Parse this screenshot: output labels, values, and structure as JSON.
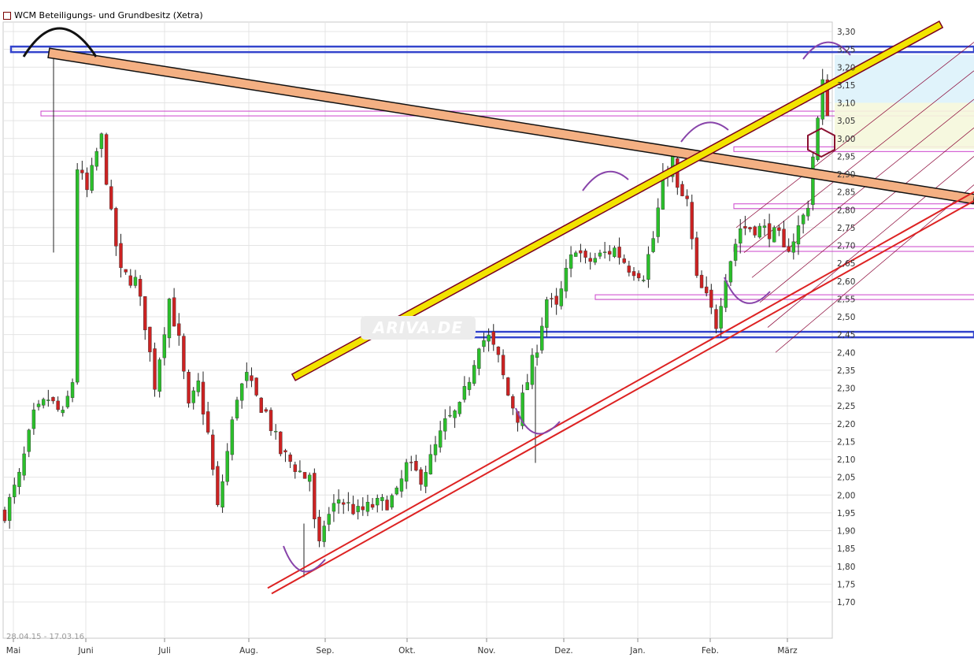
{
  "chart_data": {
    "type": "candlestick",
    "title": "WCM Beteiligungs- und Grundbesitz (Xetra)",
    "date_range": "28.04.15 - 17.03.16",
    "watermark": "ARIVA.DE",
    "y_axis_side": "right",
    "ylim": [
      1.65,
      3.32
    ],
    "y_ticks": [
      "1,70",
      "1,75",
      "1,80",
      "1,85",
      "1,90",
      "1,95",
      "2,00",
      "2,05",
      "2,10",
      "2,15",
      "2,20",
      "2,25",
      "2,30",
      "2,35",
      "2,40",
      "2,45",
      "2,50",
      "2,55",
      "2,60",
      "2,65",
      "2,70",
      "2,75",
      "2,80",
      "2,85",
      "2,90",
      "2,95",
      "3,00",
      "3,05",
      "3,10",
      "3,15",
      "3,20",
      "3,25",
      "3,30"
    ],
    "x_ticks": [
      "Mai",
      "Juni",
      "Juli",
      "Aug.",
      "Sep.",
      "Okt.",
      "Nov.",
      "Dez.",
      "Jan.",
      "Feb.",
      "März"
    ],
    "grid": true,
    "colors": {
      "up": "#2bbf2b",
      "down": "#cc2222",
      "support": "#dd2222",
      "resistance_band": "#3344cc",
      "trend_fill": "#f4b083",
      "channel_fill": "#f2e400",
      "annotation": "#cc44cc",
      "curve": "#8844aa"
    },
    "price_path": [
      [
        0,
        1.95
      ],
      [
        3,
        2.05
      ],
      [
        6,
        2.22
      ],
      [
        9,
        2.27
      ],
      [
        12,
        2.22
      ],
      [
        14,
        2.32
      ],
      [
        15,
        2.92
      ],
      [
        17,
        2.85
      ],
      [
        19,
        2.96
      ],
      [
        20,
        3.0
      ],
      [
        22,
        2.78
      ],
      [
        24,
        2.62
      ],
      [
        27,
        2.6
      ],
      [
        29,
        2.48
      ],
      [
        31,
        2.31
      ],
      [
        34,
        2.55
      ],
      [
        36,
        2.43
      ],
      [
        38,
        2.24
      ],
      [
        40,
        2.31
      ],
      [
        42,
        2.17
      ],
      [
        44,
        1.96
      ],
      [
        46,
        2.12
      ],
      [
        48,
        2.28
      ],
      [
        50,
        2.33
      ],
      [
        52,
        2.27
      ],
      [
        54,
        2.23
      ],
      [
        57,
        2.12
      ],
      [
        60,
        2.08
      ],
      [
        62,
        2.05
      ],
      [
        63,
        2.06
      ],
      [
        64,
        1.92
      ],
      [
        65,
        1.85
      ],
      [
        66,
        1.92
      ],
      [
        69,
        1.99
      ],
      [
        73,
        1.95
      ],
      [
        76,
        1.97
      ],
      [
        79,
        1.98
      ],
      [
        81,
        2.0
      ],
      [
        83,
        2.08
      ],
      [
        86,
        2.05
      ],
      [
        88,
        2.1
      ],
      [
        91,
        2.2
      ],
      [
        94,
        2.24
      ],
      [
        96,
        2.33
      ],
      [
        98,
        2.43
      ],
      [
        100,
        2.44
      ],
      [
        102,
        2.38
      ],
      [
        104,
        2.28
      ],
      [
        106,
        2.22
      ],
      [
        108,
        2.32
      ],
      [
        110,
        2.42
      ],
      [
        112,
        2.55
      ],
      [
        114,
        2.52
      ],
      [
        116,
        2.62
      ],
      [
        118,
        2.7
      ],
      [
        120,
        2.65
      ],
      [
        123,
        2.67
      ],
      [
        126,
        2.69
      ],
      [
        129,
        2.64
      ],
      [
        132,
        2.62
      ],
      [
        134,
        2.72
      ],
      [
        136,
        2.88
      ],
      [
        138,
        2.94
      ],
      [
        139,
        2.85
      ],
      [
        141,
        2.82
      ],
      [
        143,
        2.6
      ],
      [
        145,
        2.55
      ],
      [
        147,
        2.48
      ],
      [
        149,
        2.62
      ],
      [
        152,
        2.75
      ],
      [
        155,
        2.75
      ],
      [
        158,
        2.74
      ],
      [
        160,
        2.72
      ],
      [
        161,
        2.68
      ],
      [
        163,
        2.72
      ],
      [
        165,
        2.78
      ],
      [
        166,
        2.82
      ],
      [
        167,
        2.95
      ],
      [
        168,
        3.05
      ],
      [
        169,
        3.15
      ],
      [
        170,
        3.08
      ]
    ],
    "annotations": [
      {
        "type": "resistance_band",
        "y": 3.25,
        "from": "Mai",
        "to": "end"
      },
      {
        "type": "resistance_band",
        "y": 2.45,
        "from": "Okt.",
        "to": "end"
      },
      {
        "type": "level",
        "y": 3.07,
        "from": "Mai",
        "to": "end"
      },
      {
        "type": "level",
        "y": 2.97,
        "from": "Feb.",
        "to": "end"
      },
      {
        "type": "level",
        "y": 2.81,
        "from": "Feb.",
        "to": "end"
      },
      {
        "type": "level",
        "y": 2.69,
        "from": "Feb.",
        "to": "end"
      },
      {
        "type": "level",
        "y": 2.555,
        "from": "Dez.",
        "to": "end"
      },
      {
        "type": "trendline_down",
        "start": [
          "Mai",
          3.24
        ],
        "end": [
          "end",
          2.83
        ]
      },
      {
        "type": "channel_up",
        "start": [
          "Aug.",
          2.33
        ],
        "end": [
          "end",
          3.35
        ]
      },
      {
        "type": "support_up",
        "start": [
          "Aug.",
          1.75
        ],
        "end": [
          "end",
          2.85
        ]
      }
    ]
  }
}
